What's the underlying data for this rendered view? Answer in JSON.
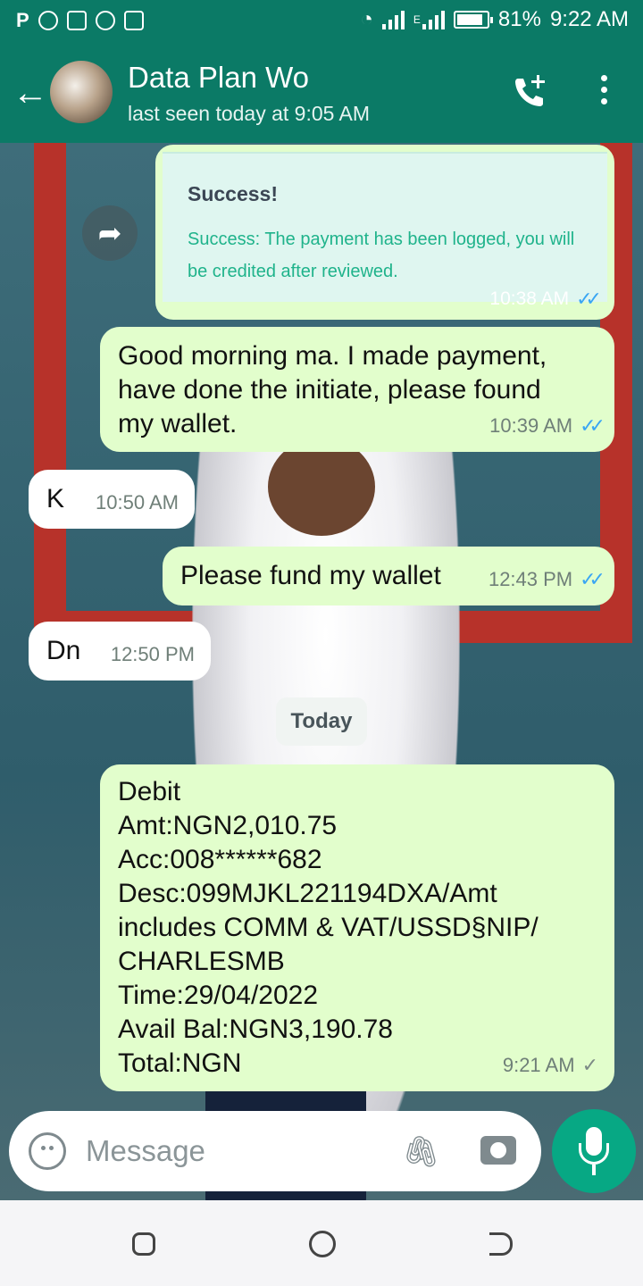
{
  "status_bar": {
    "left_icons": [
      "P",
      "chrome-icon",
      "gallery-icon",
      "whatsapp-icon",
      "pulse-icon"
    ],
    "battery": "81%",
    "time": "9:22 AM",
    "network_label": "E"
  },
  "header": {
    "contact_name": "Data Plan Wo",
    "last_seen": "last seen today at 9:05 AM"
  },
  "messages": {
    "card": {
      "title": "Success!",
      "text": "Success: The payment has been logged, you will be credited after reviewed.",
      "time": "10:38 AM"
    },
    "m1": {
      "text": "Good morning ma. I made payment, have done the initiate, please found my wallet.",
      "time": "10:39 AM"
    },
    "m2": {
      "text": "K",
      "time": "10:50 AM"
    },
    "m3": {
      "text": "Please fund my wallet",
      "time": "12:43 PM"
    },
    "m4": {
      "text": "Dn",
      "time": "12:50 PM"
    },
    "date_separator": "Today",
    "m5": {
      "lines": [
        "Debit",
        "Amt:NGN2,010.75",
        "Acc:008******682",
        "Desc:099MJKL221194DXA/Amt",
        "includes COMM & VAT/USSD§NIP/",
        "CHARLESMB",
        "Time:29/04/2022",
        "Avail Bal:NGN3,190.78",
        "Total:NGN"
      ],
      "time": "9:21 AM"
    }
  },
  "composer": {
    "placeholder": "Message"
  },
  "colors": {
    "header": "#0b7a66",
    "outgoing_bubble": "#e2fecc",
    "incoming_bubble": "#ffffff",
    "read_tick": "#3aa6f3",
    "mic_button": "#07a884"
  }
}
